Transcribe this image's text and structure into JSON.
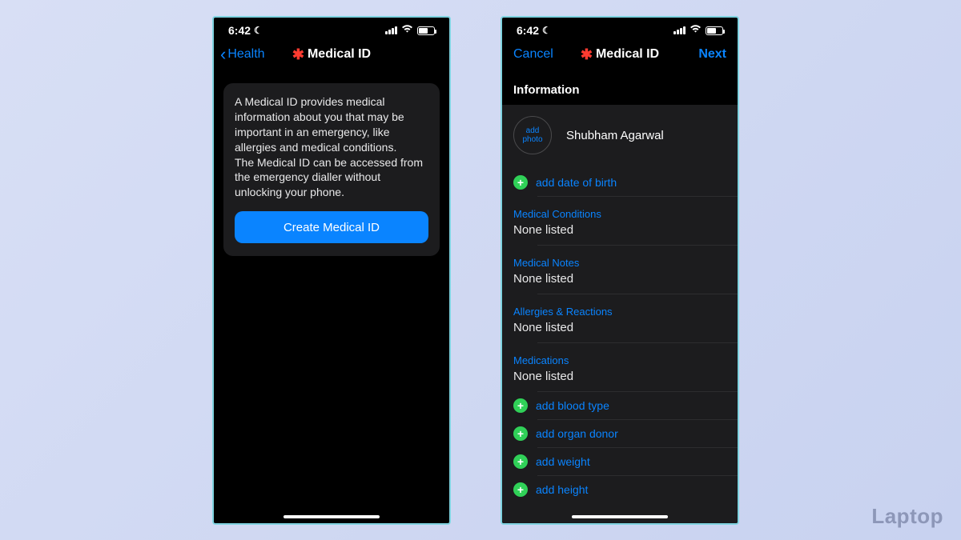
{
  "status": {
    "time": "6:42"
  },
  "phone1": {
    "back_label": "Health",
    "title": "Medical ID",
    "card_text": "A Medical ID provides medical information about you that may be important in an emergency, like allergies and medical conditions.\nThe Medical ID can be accessed from the emergency dialler without unlocking your phone.",
    "button_label": "Create Medical ID"
  },
  "phone2": {
    "cancel_label": "Cancel",
    "next_label": "Next",
    "title": "Medical ID",
    "section_title": "Information",
    "photo_label": "add\nphoto",
    "name": "Shubham Agarwal",
    "add_dob": "add date of birth",
    "fields": {
      "conditions": {
        "label": "Medical Conditions",
        "value": "None listed"
      },
      "notes": {
        "label": "Medical Notes",
        "value": "None listed"
      },
      "allergies": {
        "label": "Allergies & Reactions",
        "value": "None listed"
      },
      "medications": {
        "label": "Medications",
        "value": "None listed"
      }
    },
    "add_items": {
      "blood": "add blood type",
      "organ": "add organ donor",
      "weight": "add weight",
      "height": "add height"
    }
  },
  "watermark": "Laptop"
}
